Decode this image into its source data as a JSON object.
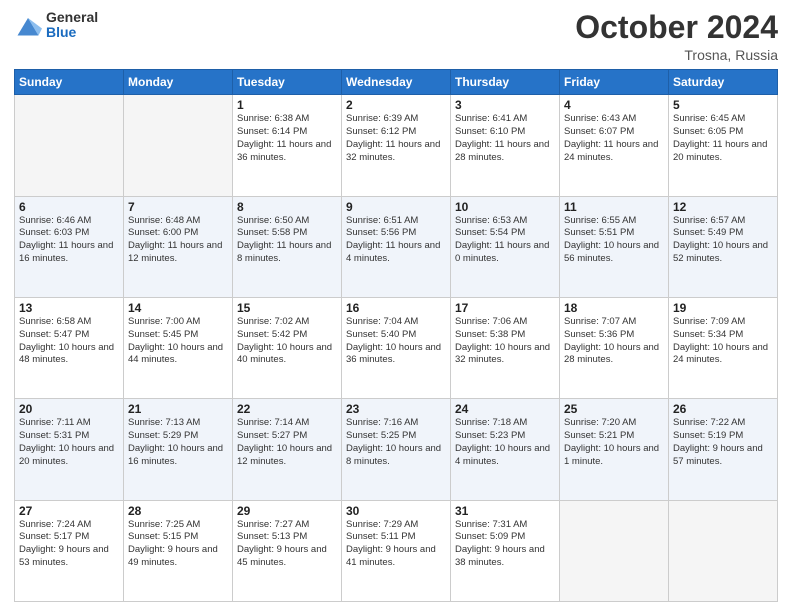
{
  "header": {
    "logo_general": "General",
    "logo_blue": "Blue",
    "month_title": "October 2024",
    "location": "Trosna, Russia"
  },
  "days_of_week": [
    "Sunday",
    "Monday",
    "Tuesday",
    "Wednesday",
    "Thursday",
    "Friday",
    "Saturday"
  ],
  "weeks": [
    [
      {
        "day": "",
        "empty": true
      },
      {
        "day": "",
        "empty": true
      },
      {
        "day": "1",
        "sunrise": "Sunrise: 6:38 AM",
        "sunset": "Sunset: 6:14 PM",
        "daylight": "Daylight: 11 hours and 36 minutes."
      },
      {
        "day": "2",
        "sunrise": "Sunrise: 6:39 AM",
        "sunset": "Sunset: 6:12 PM",
        "daylight": "Daylight: 11 hours and 32 minutes."
      },
      {
        "day": "3",
        "sunrise": "Sunrise: 6:41 AM",
        "sunset": "Sunset: 6:10 PM",
        "daylight": "Daylight: 11 hours and 28 minutes."
      },
      {
        "day": "4",
        "sunrise": "Sunrise: 6:43 AM",
        "sunset": "Sunset: 6:07 PM",
        "daylight": "Daylight: 11 hours and 24 minutes."
      },
      {
        "day": "5",
        "sunrise": "Sunrise: 6:45 AM",
        "sunset": "Sunset: 6:05 PM",
        "daylight": "Daylight: 11 hours and 20 minutes."
      }
    ],
    [
      {
        "day": "6",
        "sunrise": "Sunrise: 6:46 AM",
        "sunset": "Sunset: 6:03 PM",
        "daylight": "Daylight: 11 hours and 16 minutes."
      },
      {
        "day": "7",
        "sunrise": "Sunrise: 6:48 AM",
        "sunset": "Sunset: 6:00 PM",
        "daylight": "Daylight: 11 hours and 12 minutes."
      },
      {
        "day": "8",
        "sunrise": "Sunrise: 6:50 AM",
        "sunset": "Sunset: 5:58 PM",
        "daylight": "Daylight: 11 hours and 8 minutes."
      },
      {
        "day": "9",
        "sunrise": "Sunrise: 6:51 AM",
        "sunset": "Sunset: 5:56 PM",
        "daylight": "Daylight: 11 hours and 4 minutes."
      },
      {
        "day": "10",
        "sunrise": "Sunrise: 6:53 AM",
        "sunset": "Sunset: 5:54 PM",
        "daylight": "Daylight: 11 hours and 0 minutes."
      },
      {
        "day": "11",
        "sunrise": "Sunrise: 6:55 AM",
        "sunset": "Sunset: 5:51 PM",
        "daylight": "Daylight: 10 hours and 56 minutes."
      },
      {
        "day": "12",
        "sunrise": "Sunrise: 6:57 AM",
        "sunset": "Sunset: 5:49 PM",
        "daylight": "Daylight: 10 hours and 52 minutes."
      }
    ],
    [
      {
        "day": "13",
        "sunrise": "Sunrise: 6:58 AM",
        "sunset": "Sunset: 5:47 PM",
        "daylight": "Daylight: 10 hours and 48 minutes."
      },
      {
        "day": "14",
        "sunrise": "Sunrise: 7:00 AM",
        "sunset": "Sunset: 5:45 PM",
        "daylight": "Daylight: 10 hours and 44 minutes."
      },
      {
        "day": "15",
        "sunrise": "Sunrise: 7:02 AM",
        "sunset": "Sunset: 5:42 PM",
        "daylight": "Daylight: 10 hours and 40 minutes."
      },
      {
        "day": "16",
        "sunrise": "Sunrise: 7:04 AM",
        "sunset": "Sunset: 5:40 PM",
        "daylight": "Daylight: 10 hours and 36 minutes."
      },
      {
        "day": "17",
        "sunrise": "Sunrise: 7:06 AM",
        "sunset": "Sunset: 5:38 PM",
        "daylight": "Daylight: 10 hours and 32 minutes."
      },
      {
        "day": "18",
        "sunrise": "Sunrise: 7:07 AM",
        "sunset": "Sunset: 5:36 PM",
        "daylight": "Daylight: 10 hours and 28 minutes."
      },
      {
        "day": "19",
        "sunrise": "Sunrise: 7:09 AM",
        "sunset": "Sunset: 5:34 PM",
        "daylight": "Daylight: 10 hours and 24 minutes."
      }
    ],
    [
      {
        "day": "20",
        "sunrise": "Sunrise: 7:11 AM",
        "sunset": "Sunset: 5:31 PM",
        "daylight": "Daylight: 10 hours and 20 minutes."
      },
      {
        "day": "21",
        "sunrise": "Sunrise: 7:13 AM",
        "sunset": "Sunset: 5:29 PM",
        "daylight": "Daylight: 10 hours and 16 minutes."
      },
      {
        "day": "22",
        "sunrise": "Sunrise: 7:14 AM",
        "sunset": "Sunset: 5:27 PM",
        "daylight": "Daylight: 10 hours and 12 minutes."
      },
      {
        "day": "23",
        "sunrise": "Sunrise: 7:16 AM",
        "sunset": "Sunset: 5:25 PM",
        "daylight": "Daylight: 10 hours and 8 minutes."
      },
      {
        "day": "24",
        "sunrise": "Sunrise: 7:18 AM",
        "sunset": "Sunset: 5:23 PM",
        "daylight": "Daylight: 10 hours and 4 minutes."
      },
      {
        "day": "25",
        "sunrise": "Sunrise: 7:20 AM",
        "sunset": "Sunset: 5:21 PM",
        "daylight": "Daylight: 10 hours and 1 minute."
      },
      {
        "day": "26",
        "sunrise": "Sunrise: 7:22 AM",
        "sunset": "Sunset: 5:19 PM",
        "daylight": "Daylight: 9 hours and 57 minutes."
      }
    ],
    [
      {
        "day": "27",
        "sunrise": "Sunrise: 7:24 AM",
        "sunset": "Sunset: 5:17 PM",
        "daylight": "Daylight: 9 hours and 53 minutes."
      },
      {
        "day": "28",
        "sunrise": "Sunrise: 7:25 AM",
        "sunset": "Sunset: 5:15 PM",
        "daylight": "Daylight: 9 hours and 49 minutes."
      },
      {
        "day": "29",
        "sunrise": "Sunrise: 7:27 AM",
        "sunset": "Sunset: 5:13 PM",
        "daylight": "Daylight: 9 hours and 45 minutes."
      },
      {
        "day": "30",
        "sunrise": "Sunrise: 7:29 AM",
        "sunset": "Sunset: 5:11 PM",
        "daylight": "Daylight: 9 hours and 41 minutes."
      },
      {
        "day": "31",
        "sunrise": "Sunrise: 7:31 AM",
        "sunset": "Sunset: 5:09 PM",
        "daylight": "Daylight: 9 hours and 38 minutes."
      },
      {
        "day": "",
        "empty": true
      },
      {
        "day": "",
        "empty": true
      }
    ]
  ]
}
